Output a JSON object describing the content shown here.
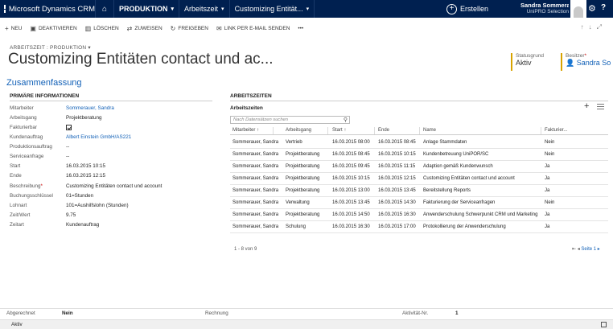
{
  "nav": {
    "brand": "Microsoft Dynamics CRM",
    "area": "PRODUKTION",
    "entity": "Arbeitszeit",
    "record": "Customizing Entität...",
    "create": "Erstellen",
    "user_name": "Sandra Sommera...",
    "user_org": "UniPRO Selection"
  },
  "commands": [
    "NEU",
    "DEAKTIVIEREN",
    "LÖSCHEN",
    "ZUWEISEN",
    "FREIGEBEN",
    "LINK PER E-MAIL SENDEN",
    "•••"
  ],
  "header": {
    "record_type": "ARBEITSZEIT : PRODUKTION",
    "title": "Customizing Entitäten contact und ac...",
    "status_label": "Statusgrund",
    "status_value": "Aktiv",
    "owner_label": "Besitzer",
    "owner_value": "Sandra So"
  },
  "section_title": "Zusammenfassung",
  "form": {
    "heading": "PRIMÄRE INFORMATIONEN",
    "fields": [
      {
        "label": "Mitarbeiter",
        "value": "Sommerauer, Sandra"
      },
      {
        "label": "Arbeitsgang",
        "value": "Projektberatung"
      },
      {
        "label": "Fakturierbar",
        "value": ""
      },
      {
        "label": "Kundenauftrag",
        "value": "Albert Einstein GmbH/AS221"
      },
      {
        "label": "Produktionsauftrag",
        "value": "--"
      },
      {
        "label": "Serviceanfrage",
        "value": "--"
      },
      {
        "label": "Start",
        "value": "16.03.2015   10:15"
      },
      {
        "label": "Ende",
        "value": "16.03.2015   12:15"
      },
      {
        "label": "Beschreibung",
        "value": "Customizing Entitäten contact und account"
      },
      {
        "label": "Buchungsschlüssel",
        "value": "01=Stunden"
      },
      {
        "label": "Lohnart",
        "value": "101=Aushilfslohn (Stunden)"
      },
      {
        "label": "Zeit/Wert",
        "value": "9.75"
      },
      {
        "label": "Zeitart",
        "value": "Kundenauftrag"
      }
    ]
  },
  "grid": {
    "heading": "ARBEITSZEITEN",
    "subheading": "Arbeitszeiten",
    "search_placeholder": "Nach Datensätzen suchen",
    "columns": [
      "Mitarbeiter ↑",
      "Arbeitsgang",
      "Start ↑",
      "Ende",
      "Name",
      "Fakturier..."
    ],
    "rows": [
      [
        "Sommerauer, Sandra",
        "Vertrieb",
        "16.03.2015 08:00",
        "16.03.2015 08:45",
        "Anlage Stammdaten",
        "Nein"
      ],
      [
        "Sommerauer, Sandra",
        "Projektberatung",
        "16.03.2015 08:45",
        "16.03.2015 10:15",
        "Kundenbetreuung UniPOR/SC",
        "Nein"
      ],
      [
        "Sommerauer, Sandra",
        "Projektberatung",
        "16.03.2015 09:45",
        "16.03.2015 11:15",
        "Adaption gemäß Kundenwunsch",
        "Ja"
      ],
      [
        "Sommerauer, Sandra",
        "Projektberatung",
        "16.03.2015 10:15",
        "16.03.2015 12:15",
        "Customizing Entitäten contact und account",
        "Ja"
      ],
      [
        "Sommerauer, Sandra",
        "Projektberatung",
        "16.03.2015 13:00",
        "16.03.2015 13:45",
        "Bereitstellung Reports",
        "Ja"
      ],
      [
        "Sommerauer, Sandra",
        "Verwaltung",
        "16.03.2015 13:45",
        "16.03.2015 14:30",
        "Fakturierung der Serviceanfragen",
        "Nein"
      ],
      [
        "Sommerauer, Sandra",
        "Projektberatung",
        "16.03.2015 14:50",
        "16.03.2015 16:30",
        "Anwenderschulung Schwerpunkt CRM und Marketing",
        "Ja"
      ],
      [
        "Sommerauer, Sandra",
        "Schulung",
        "16.03.2015 16:30",
        "16.03.2015 17:00",
        "Protokollierung der Anwenderschulung",
        "Ja"
      ]
    ],
    "footer_count": "1 - 8  von 9",
    "footer_page": "Seite 1"
  },
  "bottom": {
    "abgerechnet_label": "Abgerechnet",
    "abgerechnet_value": "Nein",
    "rechnung_label": "Rechnung",
    "aktivitaet_label": "Aktivität-Nr.",
    "aktivitaet_value": "1",
    "status": "Aktiv"
  }
}
